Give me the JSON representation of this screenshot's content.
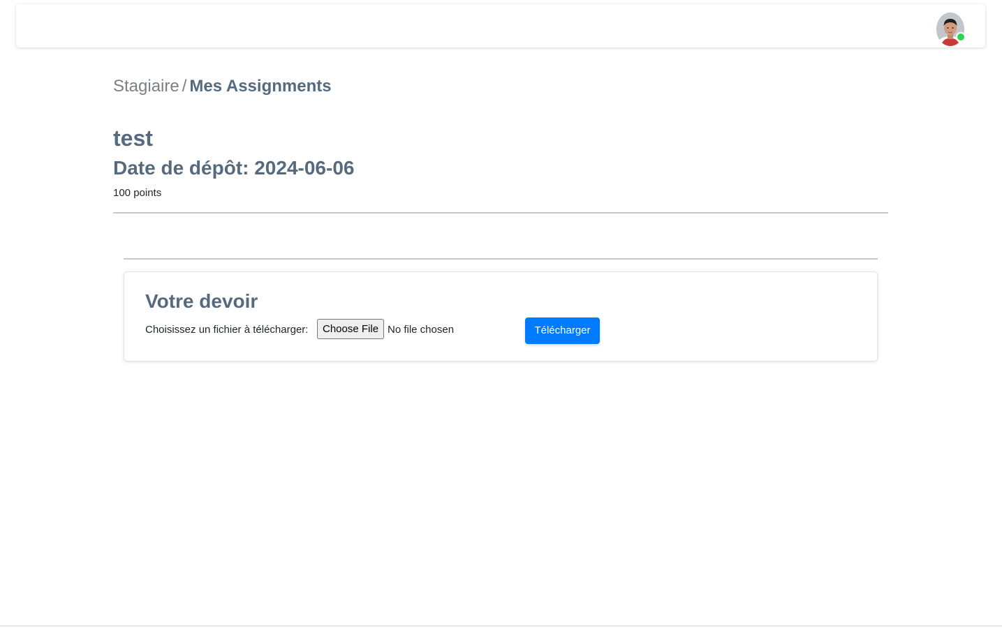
{
  "navbar": {
    "avatar_icon": "user-avatar",
    "status": "online",
    "status_color": "#2fd24d"
  },
  "breadcrumb": {
    "root": "Stagiaire",
    "separator": "/",
    "current": "Mes Assignments"
  },
  "assignment": {
    "title": "test",
    "due_date": "Date de dépôt: 2024-06-06",
    "points": "100 points"
  },
  "submission": {
    "heading": "Votre devoir",
    "file_label": "Choisissez un fichier à télécharger:",
    "file_button": "Choose File",
    "file_status": "No file chosen",
    "upload_button": "Télécharger"
  },
  "colors": {
    "heading": "#566a7f",
    "primary": "#007bff"
  }
}
